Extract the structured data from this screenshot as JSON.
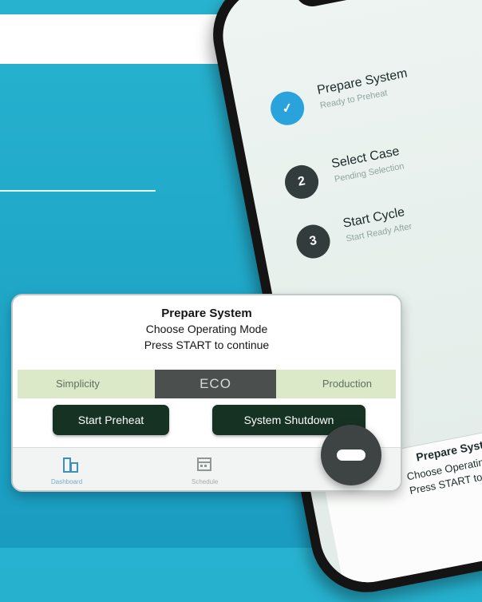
{
  "phone": {
    "steps": [
      {
        "title": "Prepare System",
        "subtitle": "Ready to Preheat",
        "state": "done"
      },
      {
        "number": "2",
        "title": "Select Case",
        "subtitle": "Pending Selection"
      },
      {
        "number": "3",
        "title": "Start Cycle",
        "subtitle": "Start Ready After"
      }
    ],
    "panel": {
      "title": "Prepare System",
      "line1": "Choose Operating Mode",
      "line2": "Press START to continue"
    }
  },
  "card": {
    "title": "Prepare System",
    "line1": "Choose Operating Mode",
    "line2": "Press START to continue",
    "modes": {
      "left": "Simplicity",
      "center": "ECO",
      "right": "Production"
    },
    "buttons": {
      "left": "Start Preheat",
      "right": "System Shutdown"
    },
    "tabs": [
      {
        "label": "Dashboard",
        "icon": "dashboard-icon"
      },
      {
        "label": "Schedule",
        "icon": "calendar-icon"
      }
    ]
  },
  "colors": {
    "background": "#22add0",
    "check": "#2aa3dc",
    "button": "#153222",
    "mode_bar": "#dbe9c9",
    "eco": "#4b504e"
  }
}
